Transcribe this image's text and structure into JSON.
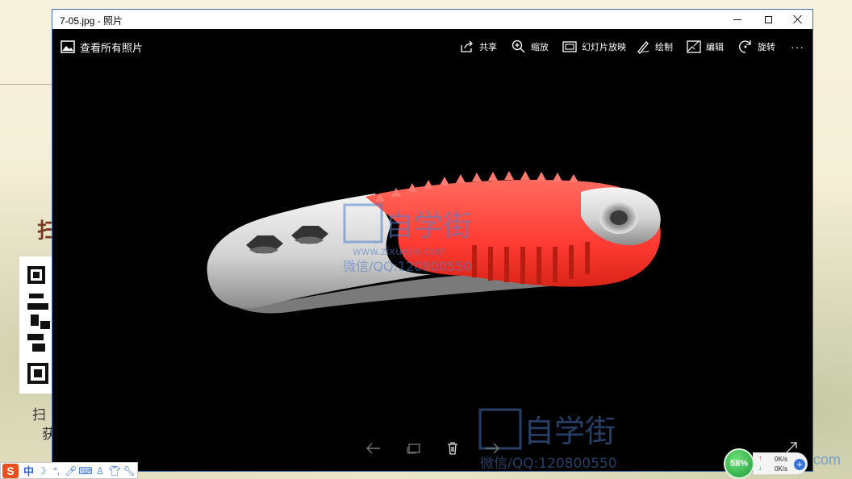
{
  "window": {
    "title": "7-05.jpg - 照片"
  },
  "toolbar": {
    "view_all": "查看所有照片",
    "share": "共享",
    "zoom": "缩放",
    "slideshow": "幻灯片放映",
    "draw": "绘制",
    "edit": "编辑",
    "rotate": "旋转",
    "more": "···"
  },
  "watermarks": {
    "brand": "自学街",
    "site": "www.zixuejie.com",
    "contact": "微信/QQ:120800550"
  },
  "desktop": {
    "partial_char": "扫",
    "partial_text1": "扫",
    "partial_text2": "获",
    "partial_mark": "com"
  },
  "ime": {
    "logo": "S",
    "mode": "中"
  },
  "network": {
    "percent": "58%",
    "upload": "0K/s",
    "download": "0K/s"
  },
  "colors": {
    "handle_red": "#ff3b3b",
    "handle_grey": "#d6d6d6",
    "window_border": "#3b6fb2"
  },
  "icons": {
    "photos": "photo-icon",
    "share": "share-icon",
    "zoom": "zoom-icon",
    "slideshow": "slideshow-icon",
    "draw": "pen-icon",
    "edit": "edit-icon",
    "rotate": "rotate-icon"
  }
}
